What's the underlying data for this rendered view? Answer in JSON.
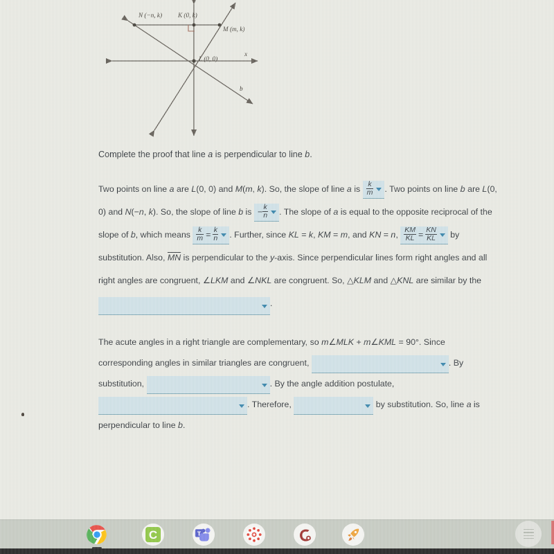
{
  "diagram": {
    "labels": {
      "n_point": "N (−n, k)",
      "k_point": "K (0, k)",
      "m_point": "M (m, k)",
      "l_point": "L (0, 0)",
      "x_axis": "x",
      "line_b": "b"
    }
  },
  "proof": {
    "prompt": {
      "p1": "Complete the proof that line ",
      "a1": "a",
      "p2": " is perpendicular to line ",
      "b1": "b",
      "p3": "."
    },
    "para1": {
      "s1": "Two points on line ",
      "a1": "a",
      "s2": " are ",
      "L1": "L",
      "s3": "(0, 0) and ",
      "M1": "M",
      "s4": "(",
      "m1": "m",
      "s5": ", ",
      "k1": "k",
      "s6": "). So, the slope of line ",
      "a2": "a",
      "s7": " is ",
      "s8": ". Two points on line ",
      "b1": "b",
      "s9": " are ",
      "L2": "L",
      "s10": "(0, 0) and ",
      "N1": "N",
      "s11": "(−",
      "n1": "n",
      "s12": ", ",
      "k2": "k",
      "s13": "). So, the slope of line ",
      "b2": "b",
      "s14": " is ",
      "s15": ". The slope of ",
      "a3": "a",
      "s16": " is equal to the opposite reciprocal of the slope of ",
      "b3": "b",
      "s17": ", which means ",
      "s18": ". Further, since ",
      "KL1": "KL",
      "s19": " = ",
      "k3": "k",
      "s20": ", ",
      "KM1": "KM",
      "s21": " = ",
      "m2": "m",
      "s22": ", and ",
      "KN1": "KN",
      "s23": " = ",
      "n2": "n",
      "s24": ", ",
      "s25": " by substitution. Also, ",
      "MN1": "MN",
      "s26": " is perpendicular to the ",
      "y1": "y",
      "s27": "-axis. Since perpendicular lines form right angles and all right angles are congruent, ∠",
      "LKM1": "LKM",
      "s28": " and ∠",
      "NKL1": "NKL",
      "s29": " are congruent. So, △",
      "KLM1": "KLM",
      "s30": " and △",
      "KNL1": "KNL",
      "s31": " are similar by the",
      "s32": "."
    },
    "para2": {
      "t1": "The acute angles in a right triangle are complementary, so ",
      "m1": "m",
      "t2": "∠",
      "MLK1": "MLK",
      "t3": " + ",
      "m2": "m",
      "t4": "∠",
      "KML1": "KML",
      "t5": " = 90°. Since corresponding angles in similar triangles are congruent, ",
      "t6": ". By substitution, ",
      "t7": ". By the angle addition postulate, ",
      "t8": ". Therefore, ",
      "t9": " by substitution. So, line ",
      "a1": "a",
      "t10": " is perpendicular to line ",
      "b1": "b",
      "t11": "."
    },
    "dropdowns": {
      "slope_a": {
        "type": "fraction",
        "numerator": "k",
        "denominator": "m",
        "negative": false
      },
      "slope_b": {
        "type": "fraction",
        "numerator": "k",
        "denominator": "n",
        "negative": true
      },
      "reciprocal": {
        "type": "fraction-equation",
        "left_num": "k",
        "left_den": "m",
        "right_num": "k",
        "right_den": "n"
      },
      "substitution_ratio": {
        "type": "fraction-equation",
        "left_num": "KM",
        "left_den": "KL",
        "right_num": "KN",
        "right_den": "KL"
      },
      "similarity_reason": {
        "type": "blank",
        "value": ""
      },
      "corresponding_angles": {
        "type": "blank",
        "value": ""
      },
      "substitution_step": {
        "type": "blank",
        "value": ""
      },
      "angle_addition": {
        "type": "blank",
        "value": ""
      },
      "conclusion": {
        "type": "blank",
        "value": ""
      }
    }
  },
  "taskbar": {
    "items": [
      {
        "name": "chrome-icon",
        "label": "Google Chrome",
        "running": true
      },
      {
        "name": "canvas-student-icon",
        "label": "C",
        "running": false
      },
      {
        "name": "microsoft-teams-icon",
        "label": "Teams",
        "running": false
      },
      {
        "name": "canvas-icon",
        "label": "Canvas",
        "running": false
      },
      {
        "name": "remind-icon",
        "label": "Remind",
        "running": false
      },
      {
        "name": "rocket-icon",
        "label": "Rocket",
        "running": false
      }
    ],
    "tray": {
      "name": "notes-widget",
      "label": ""
    }
  },
  "colors": {
    "page_background": "#eaebe4",
    "text": "#2e3338",
    "dropdown_fill": "#cfe2e8",
    "dropdown_underline": "#7ba7b5",
    "dropdown_caret": "#2e7fa8",
    "diagram_stroke": "#5c5750",
    "taskbar": "#c6cbc2"
  }
}
